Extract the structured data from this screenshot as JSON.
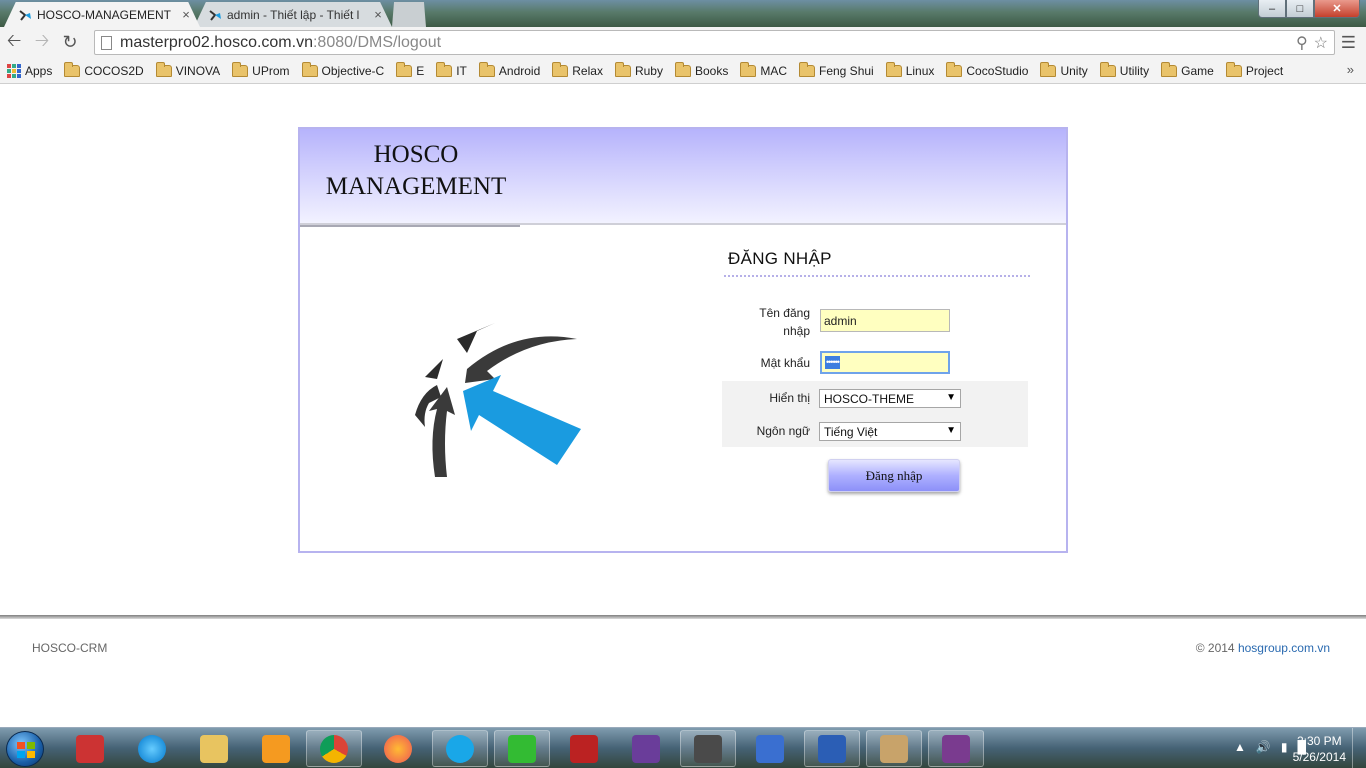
{
  "browser": {
    "tabs": [
      {
        "title": "HOSCO-MANAGEMENT",
        "close": "×"
      },
      {
        "title": "admin - Thiết lập - Thiết l",
        "close": "×"
      }
    ],
    "url_host": "masterpro02.hosco.com.vn",
    "url_rest": ":8080/DMS/logout",
    "bookmarks": [
      "Apps",
      "COCOS2D",
      "VINOVA",
      "UProm",
      "Objective-C",
      "E",
      "IT",
      "Android",
      "Relax",
      "Ruby",
      "Books",
      "MAC",
      "Feng Shui",
      "Linux",
      "CocoStudio",
      "Unity",
      "Utility",
      "Game",
      "Project"
    ],
    "more": "»"
  },
  "header": {
    "brand_line1": "HOSCO",
    "brand_line2": "MANAGEMENT"
  },
  "login": {
    "title": "ĐĂNG NHẬP",
    "username_label_1": "Tên đăng",
    "username_label_2": "nhập",
    "username_value": "admin",
    "password_label": "Mật khẩu",
    "password_mask": "••••••",
    "theme_label": "Hiển thị",
    "theme_value": "HOSCO-THEME",
    "language_label": "Ngôn ngữ",
    "language_value": "Tiếng Việt",
    "submit_label": "Đăng nhập",
    "dropdown_arrow": "▼"
  },
  "footer": {
    "left": "HOSCO-CRM",
    "right_prefix": "© 2014 ",
    "right_link": "hosgroup.com.vn"
  },
  "taskbar": {
    "time": "2:30 PM",
    "date": "5/26/2014"
  },
  "colors": {
    "header_gradient_top": "#b6b3fc",
    "box_border": "#b7b3ef",
    "input_bg": "#ffffc0",
    "logo_arrow": "#1a9be0"
  }
}
